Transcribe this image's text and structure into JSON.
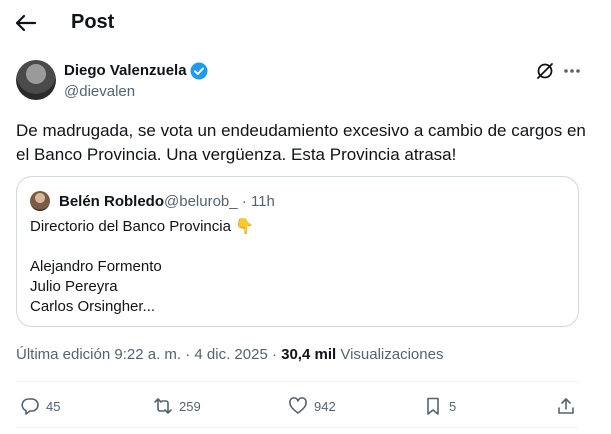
{
  "header": {
    "title": "Post"
  },
  "author": {
    "name": "Diego Valenzuela",
    "handle": "@dievalen"
  },
  "tweet": {
    "text": "De madrugada, se vota un endeudamiento excesivo a cambio de cargos en el Banco Provincia. Una vergüenza. Esta Provincia atrasa!"
  },
  "quote": {
    "name": "Belén Robledo",
    "meta": "@belurob_ · 11h",
    "lines": [
      "Directorio del Banco Provincia",
      "Alejandro Formento",
      "Julio Pereyra",
      "Carlos Orsingher..."
    ]
  },
  "meta": {
    "edited": "Última edición 9:22 a. m. · 4 dic. 2025 · ",
    "views_count": "30,4 mil",
    "views_label": " Visualizaciones"
  },
  "actions": {
    "replies": "45",
    "reposts": "259",
    "likes": "942",
    "bookmarks": "5"
  },
  "colors": {
    "verified": "#1d9bf0",
    "muted": "#536471",
    "text": "#0f1419"
  },
  "icons": [
    "back-arrow-icon",
    "verified-icon",
    "grok-icon",
    "more-icon",
    "reply-icon",
    "repost-icon",
    "like-icon",
    "bookmark-icon",
    "share-icon",
    "pointing-hand-emoji"
  ]
}
